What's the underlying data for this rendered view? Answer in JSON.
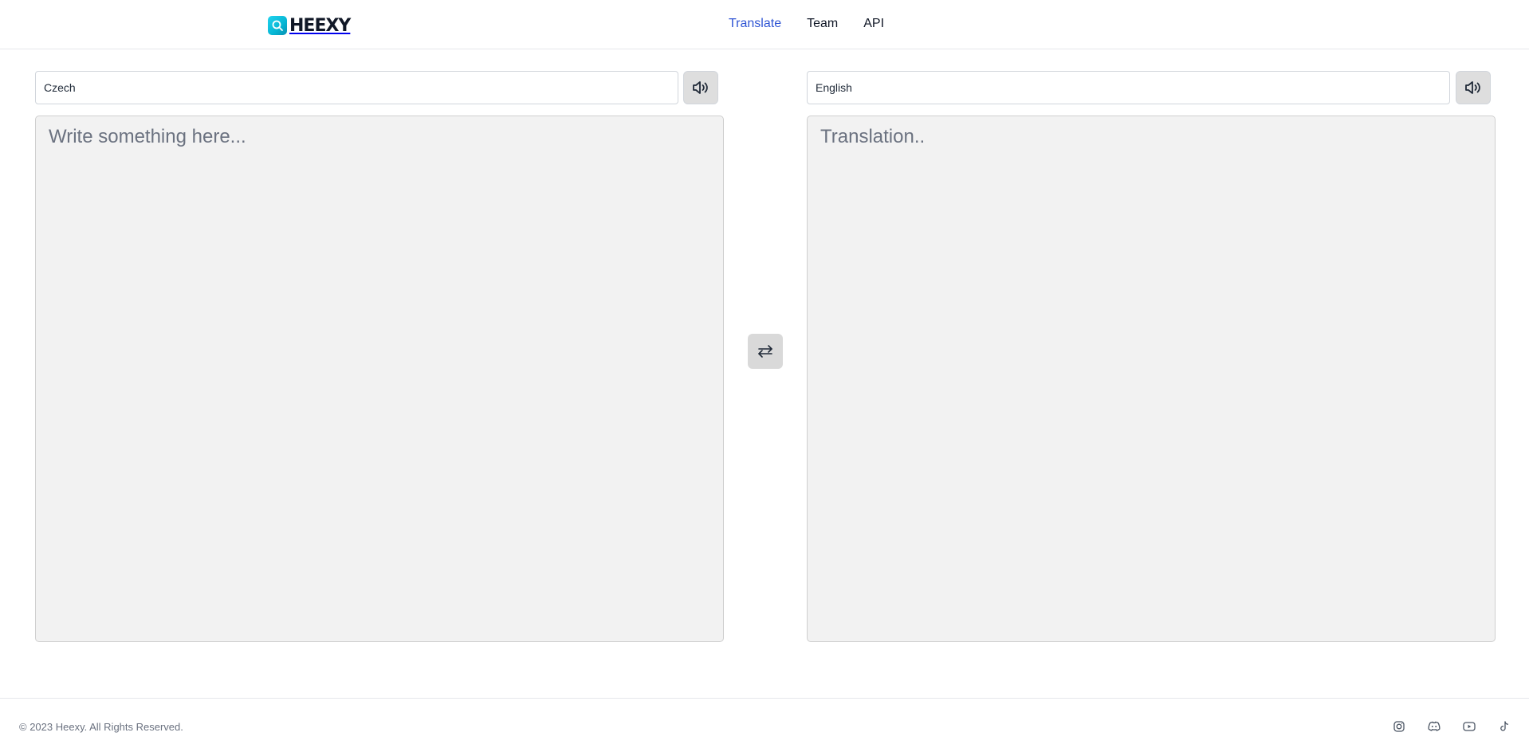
{
  "header": {
    "logo_text": "HEEXY",
    "nav": [
      {
        "label": "Translate",
        "active": true
      },
      {
        "label": "Team",
        "active": false
      },
      {
        "label": "API",
        "active": false
      }
    ]
  },
  "source": {
    "language": "Czech",
    "placeholder": "Write something here...",
    "speak_icon": "speaker-icon"
  },
  "target": {
    "language": "English",
    "placeholder": "Translation..",
    "speak_icon": "speaker-icon"
  },
  "swap_icon": "swap-arrows-icon",
  "footer": {
    "copyright": "© 2023 Heexy. All Rights Reserved.",
    "social_icons": [
      "instagram-icon",
      "discord-icon",
      "youtube-icon",
      "tiktok-icon"
    ]
  },
  "colors": {
    "accent": "#2f55d4",
    "logo_cyan": "#06b6d4",
    "pane_bg": "#f2f2f2",
    "button_bg": "#dedede"
  }
}
